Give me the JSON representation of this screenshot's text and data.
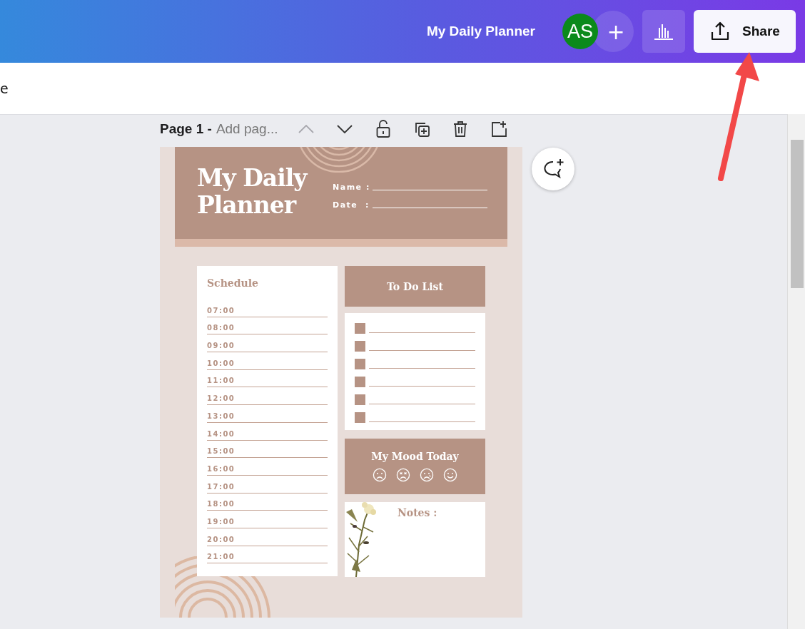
{
  "topbar": {
    "title": "My Daily Planner",
    "avatar": "AS",
    "add_symbol": "+",
    "share": "Share"
  },
  "toolbar": {
    "cut_text": "e"
  },
  "page_bar": {
    "page": "Page 1 -",
    "title_placeholder": "Add pag...",
    "up_disabled": true
  },
  "planner": {
    "title_line1": "My Daily",
    "title_line2": "Planner",
    "fields": [
      {
        "label": "Name :"
      },
      {
        "label": "Date  :"
      }
    ],
    "schedule": {
      "heading": "Schedule",
      "times": [
        "07:00",
        "08:00",
        "09:00",
        "10:00",
        "11:00",
        "12:00",
        "13:00",
        "14:00",
        "15:00",
        "16:00",
        "17:00",
        "18:00",
        "19:00",
        "20:00",
        "21:00"
      ]
    },
    "todo": {
      "heading": "To Do List",
      "rows": [
        {
          "checked": false
        },
        {
          "checked": false
        },
        {
          "checked": false
        },
        {
          "checked": false
        },
        {
          "checked": false
        },
        {
          "checked": false
        }
      ]
    },
    "mood": {
      "heading": "My Mood Today",
      "faces": [
        {
          "kind": "sad"
        },
        {
          "kind": "angry"
        },
        {
          "kind": "worried"
        },
        {
          "kind": "happy"
        }
      ]
    },
    "notes": {
      "heading": "Notes :"
    }
  }
}
